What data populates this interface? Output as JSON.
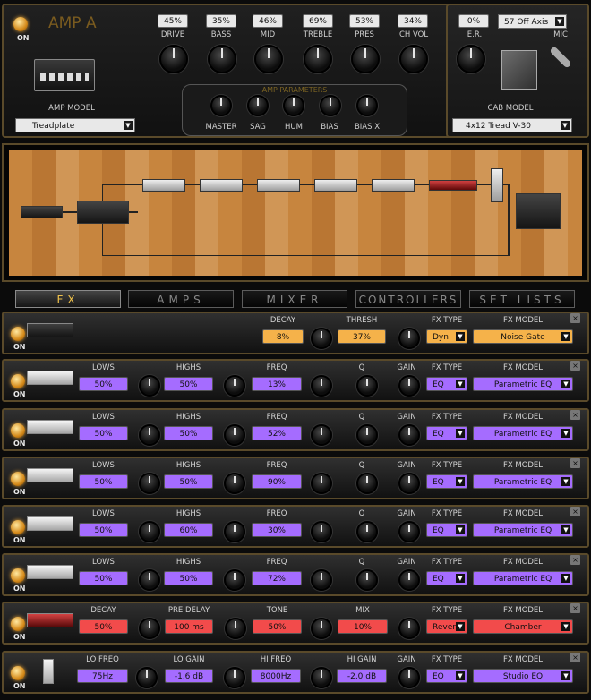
{
  "amp": {
    "title": "AMP A",
    "on_label": "ON",
    "amp_model_label": "AMP MODEL",
    "amp_model_value": "Treadplate",
    "controls": [
      {
        "label": "DRIVE",
        "value": "45%"
      },
      {
        "label": "BASS",
        "value": "35%"
      },
      {
        "label": "MID",
        "value": "46%"
      },
      {
        "label": "TREBLE",
        "value": "69%"
      },
      {
        "label": "PRES",
        "value": "53%"
      },
      {
        "label": "CH VOL",
        "value": "34%"
      }
    ],
    "parameters_title": "AMP PARAMETERS",
    "parameters": [
      "MASTER",
      "SAG",
      "HUM",
      "BIAS",
      "BIAS X"
    ]
  },
  "cab": {
    "er_label": "E.R.",
    "er_value": "0%",
    "mic_label": "MIC",
    "mic_value": "57 Off Axis",
    "cab_model_label": "CAB MODEL",
    "cab_model_value": "4x12 Tread V-30"
  },
  "tabs": [
    "FX",
    "AMPS",
    "MIXER",
    "CONTROLLERS",
    "SET LISTS"
  ],
  "fx_rows": [
    {
      "on_label": "ON",
      "params": [
        {
          "label": "DECAY",
          "value": "8%",
          "color": "#f5b24a"
        },
        {
          "label": "THRESH",
          "value": "37%",
          "color": "#f5b24a"
        }
      ],
      "fx_type_label": "FX TYPE",
      "fx_type_value": "Dyn",
      "fx_model_label": "FX MODEL",
      "fx_model_value": "Noise Gate",
      "accent": "#f5b24a"
    },
    {
      "on_label": "ON",
      "params": [
        {
          "label": "LOWS",
          "value": "50%",
          "color": "#a56cff"
        },
        {
          "label": "HIGHS",
          "value": "50%",
          "color": "#a56cff"
        },
        {
          "label": "FREQ",
          "value": "13%",
          "color": "#a56cff"
        },
        {
          "label": "Q",
          "value": "",
          "color": ""
        },
        {
          "label": "GAIN",
          "value": "",
          "color": ""
        }
      ],
      "fx_type_label": "FX TYPE",
      "fx_type_value": "EQ",
      "fx_model_label": "FX MODEL",
      "fx_model_value": "Parametric EQ",
      "accent": "#a56cff"
    },
    {
      "on_label": "ON",
      "params": [
        {
          "label": "LOWS",
          "value": "50%",
          "color": "#a56cff"
        },
        {
          "label": "HIGHS",
          "value": "50%",
          "color": "#a56cff"
        },
        {
          "label": "FREQ",
          "value": "52%",
          "color": "#a56cff"
        },
        {
          "label": "Q",
          "value": "",
          "color": ""
        },
        {
          "label": "GAIN",
          "value": "",
          "color": ""
        }
      ],
      "fx_type_label": "FX TYPE",
      "fx_type_value": "EQ",
      "fx_model_label": "FX MODEL",
      "fx_model_value": "Parametric EQ",
      "accent": "#a56cff"
    },
    {
      "on_label": "ON",
      "params": [
        {
          "label": "LOWS",
          "value": "50%",
          "color": "#a56cff"
        },
        {
          "label": "HIGHS",
          "value": "50%",
          "color": "#a56cff"
        },
        {
          "label": "FREQ",
          "value": "90%",
          "color": "#a56cff"
        },
        {
          "label": "Q",
          "value": "",
          "color": ""
        },
        {
          "label": "GAIN",
          "value": "",
          "color": ""
        }
      ],
      "fx_type_label": "FX TYPE",
      "fx_type_value": "EQ",
      "fx_model_label": "FX MODEL",
      "fx_model_value": "Parametric EQ",
      "accent": "#a56cff"
    },
    {
      "on_label": "ON",
      "params": [
        {
          "label": "LOWS",
          "value": "50%",
          "color": "#a56cff"
        },
        {
          "label": "HIGHS",
          "value": "60%",
          "color": "#a56cff"
        },
        {
          "label": "FREQ",
          "value": "30%",
          "color": "#a56cff"
        },
        {
          "label": "Q",
          "value": "",
          "color": ""
        },
        {
          "label": "GAIN",
          "value": "",
          "color": ""
        }
      ],
      "fx_type_label": "FX TYPE",
      "fx_type_value": "EQ",
      "fx_model_label": "FX MODEL",
      "fx_model_value": "Parametric EQ",
      "accent": "#a56cff"
    },
    {
      "on_label": "ON",
      "params": [
        {
          "label": "LOWS",
          "value": "50%",
          "color": "#a56cff"
        },
        {
          "label": "HIGHS",
          "value": "50%",
          "color": "#a56cff"
        },
        {
          "label": "FREQ",
          "value": "72%",
          "color": "#a56cff"
        },
        {
          "label": "Q",
          "value": "",
          "color": ""
        },
        {
          "label": "GAIN",
          "value": "",
          "color": ""
        }
      ],
      "fx_type_label": "FX TYPE",
      "fx_type_value": "EQ",
      "fx_model_label": "FX MODEL",
      "fx_model_value": "Parametric EQ",
      "accent": "#a56cff"
    },
    {
      "on_label": "ON",
      "params": [
        {
          "label": "DECAY",
          "value": "50%",
          "color": "#f24b4b"
        },
        {
          "label": "PRE DELAY",
          "value": "100 ms",
          "color": "#f24b4b"
        },
        {
          "label": "TONE",
          "value": "50%",
          "color": "#f24b4b"
        },
        {
          "label": "MIX",
          "value": "10%",
          "color": "#f24b4b"
        }
      ],
      "fx_type_label": "FX TYPE",
      "fx_type_value": "Reverb",
      "fx_model_label": "FX MODEL",
      "fx_model_value": "Chamber",
      "accent": "#f24b4b"
    },
    {
      "on_label": "ON",
      "params": [
        {
          "label": "LO FREQ",
          "value": "75Hz",
          "color": "#a56cff"
        },
        {
          "label": "LO GAIN",
          "value": "-1.6 dB",
          "color": "#a56cff"
        },
        {
          "label": "HI FREQ",
          "value": "8000Hz",
          "color": "#a56cff"
        },
        {
          "label": "HI GAIN",
          "value": "-2.0 dB",
          "color": "#a56cff"
        },
        {
          "label": "GAIN",
          "value": "",
          "color": ""
        }
      ],
      "fx_type_label": "FX TYPE",
      "fx_type_value": "EQ",
      "fx_model_label": "FX MODEL",
      "fx_model_value": "Studio EQ",
      "accent": "#a56cff"
    }
  ]
}
